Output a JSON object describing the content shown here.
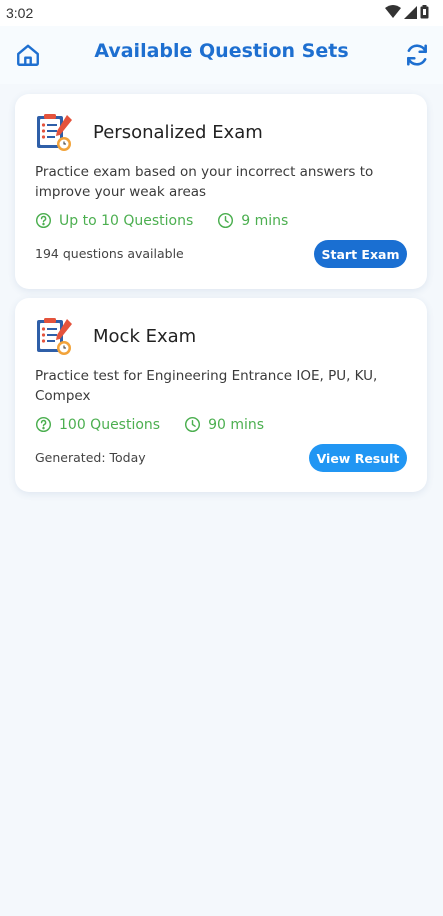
{
  "status_bar": {
    "time": "3:02"
  },
  "header": {
    "title": "Available Question Sets",
    "home_icon": "home-icon",
    "refresh_icon": "refresh-icon",
    "accent_color": "#1e6fd0"
  },
  "exams": [
    {
      "title": "Personalized Exam",
      "description": "Practice exam based on your incorrect answers to improve your weak areas",
      "questions": "Up to 10 Questions",
      "duration": "9 mins",
      "footer": "194 questions available",
      "button": "Start Exam",
      "button_color": "#1a6fd2"
    },
    {
      "title": "Mock Exam",
      "description": "Practice test for Engineering Entrance IOE, PU, KU, Compex",
      "questions": "100 Questions",
      "duration": "90 mins",
      "footer": "Generated: Today",
      "button": "View Result",
      "button_color": "#2196f3"
    }
  ],
  "meta_color": "#4caf50"
}
